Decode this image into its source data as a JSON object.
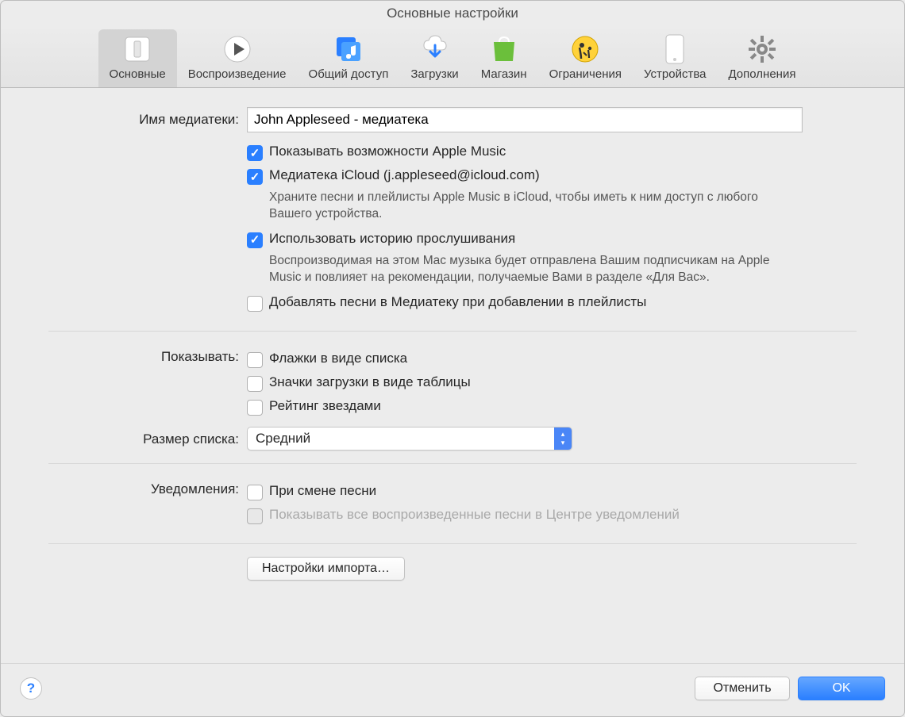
{
  "window_title": "Основные настройки",
  "toolbar": {
    "tabs": [
      {
        "label": "Основные",
        "icon": "switch-icon"
      },
      {
        "label": "Воспроизведение",
        "icon": "play-icon"
      },
      {
        "label": "Общий доступ",
        "icon": "music-share-icon"
      },
      {
        "label": "Загрузки",
        "icon": "download-cloud-icon"
      },
      {
        "label": "Магазин",
        "icon": "store-bag-icon"
      },
      {
        "label": "Ограничения",
        "icon": "parental-icon"
      },
      {
        "label": "Устройства",
        "icon": "device-icon"
      },
      {
        "label": "Дополнения",
        "icon": "gear-icon"
      }
    ]
  },
  "labels": {
    "library_name": "Имя медиатеки:",
    "show": "Показывать:",
    "list_size": "Размер списка:",
    "notifications": "Уведомления:"
  },
  "library_name_value": "John Appleseed - медиатека",
  "checks": {
    "apple_music_features": "Показывать возможности Apple Music",
    "icloud_library": "Медиатека iCloud (j.appleseed@icloud.com)",
    "icloud_library_desc": "Храните песни и плейлисты Apple Music в iCloud, чтобы иметь к ним доступ с любого Вашего устройства.",
    "listening_history": "Использовать историю прослушивания",
    "listening_history_desc": "Воспроизводимая на этом Mac музыка будет отправлена Вашим подписчикам на Apple Music и повлияет на рекомендации, получаемые Вами в разделе «Для Вас».",
    "add_to_library": "Добавлять песни в Медиатеку при добавлении в плейлисты",
    "list_view_checkboxes": "Флажки в виде списка",
    "download_icons": "Значки загрузки в виде таблицы",
    "star_rating": "Рейтинг звездами",
    "on_song_change": "При смене песни",
    "show_all_in_nc": "Показывать все воспроизведенные песни в Центре уведомлений"
  },
  "list_size_value": "Средний",
  "import_settings_button": "Настройки импорта…",
  "footer": {
    "cancel": "Отменить",
    "ok": "OK"
  },
  "colors": {
    "accent": "#2a7fff"
  }
}
